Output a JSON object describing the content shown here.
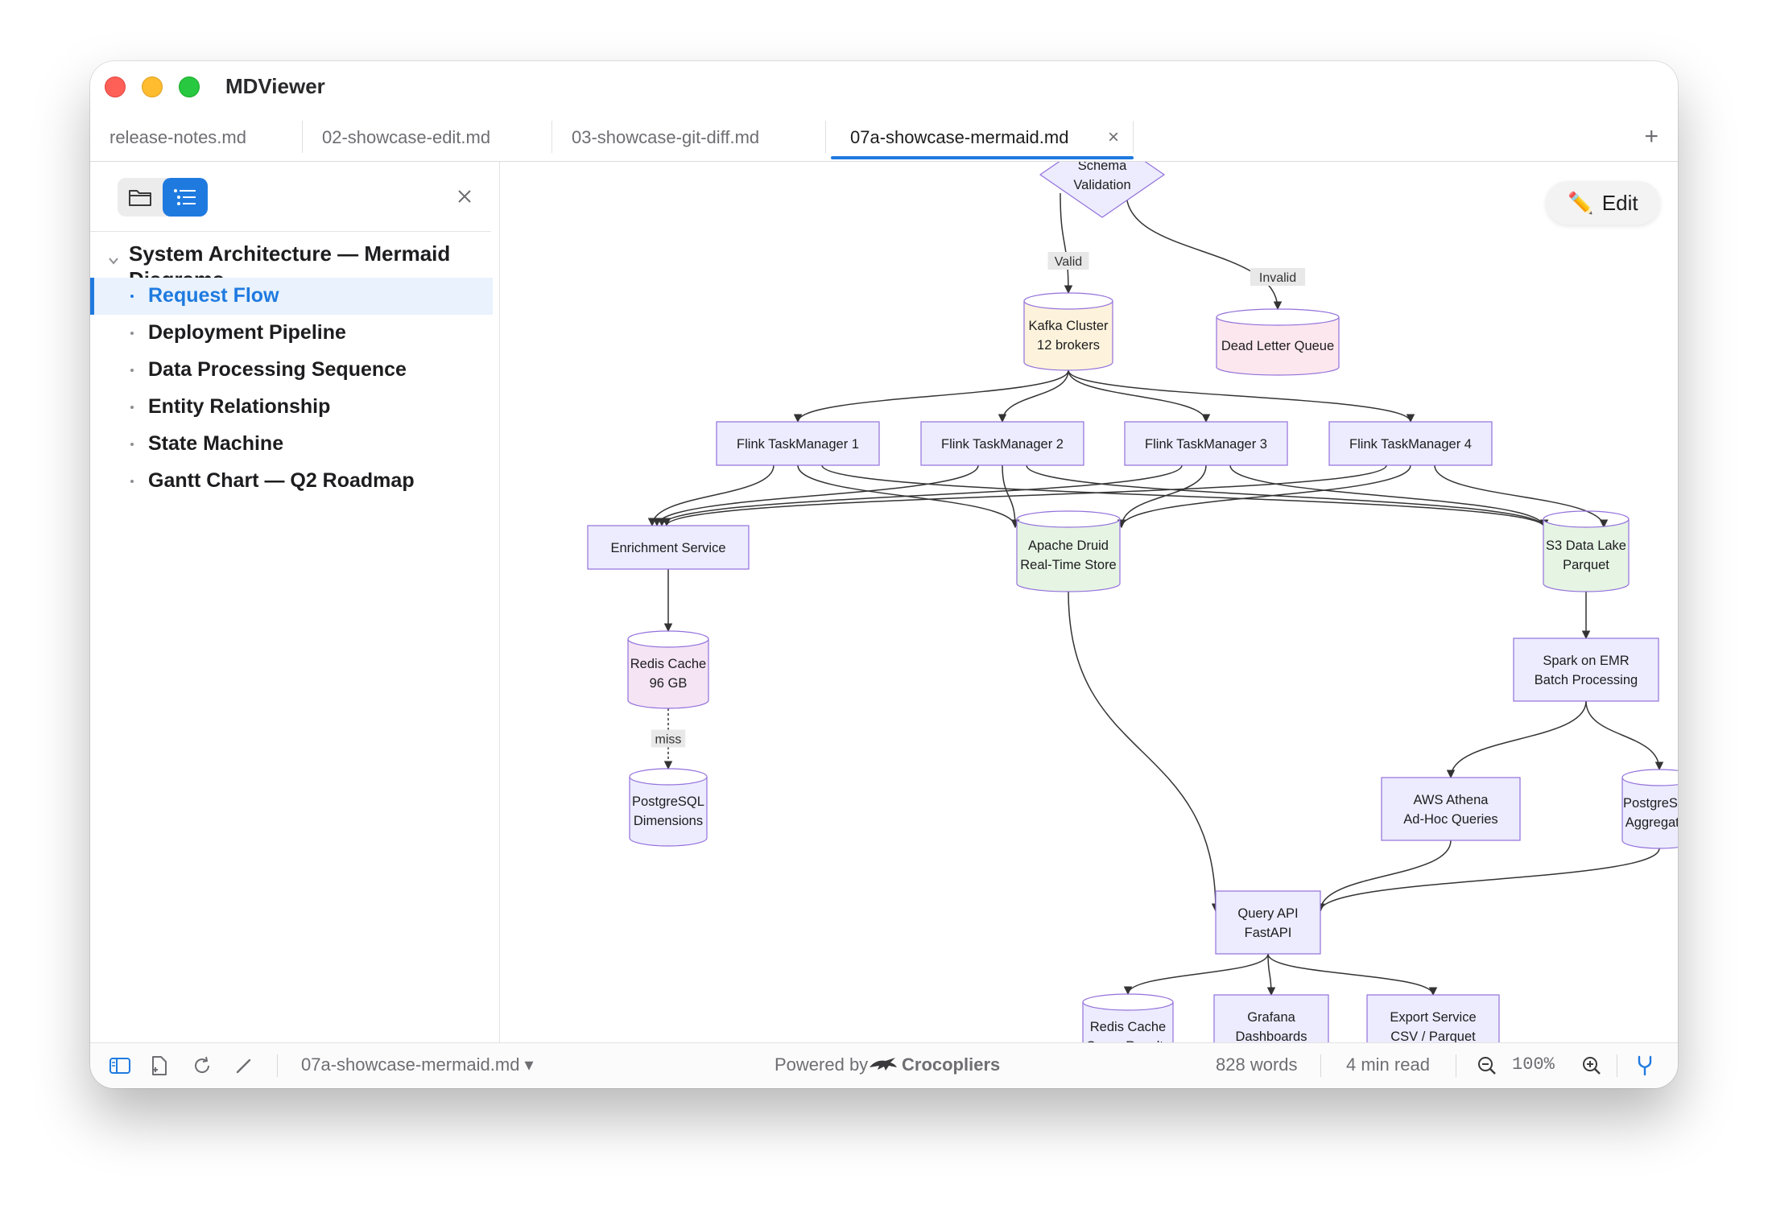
{
  "app": {
    "title": "MDViewer"
  },
  "tabs": [
    {
      "label": "release-notes.md"
    },
    {
      "label": "02-showcase-edit.md"
    },
    {
      "label": "03-showcase-git-diff.md"
    },
    {
      "label": "07a-showcase-mermaid.md",
      "active": true,
      "close_glyph": "×"
    }
  ],
  "tab_add_glyph": "+",
  "sidebar": {
    "outline_title": "System Architecture — Mermaid Diagrams",
    "items": [
      {
        "label": "Request Flow",
        "active": true
      },
      {
        "label": "Deployment Pipeline"
      },
      {
        "label": "Data Processing Sequence"
      },
      {
        "label": "Entity Relationship"
      },
      {
        "label": "State Machine"
      },
      {
        "label": "Gantt Chart — Q2 Roadmap"
      }
    ],
    "icons": [
      "folder-icon",
      "outline-list-icon",
      "close-icon"
    ]
  },
  "edit_button": {
    "label": "Edit",
    "icon": "✏️"
  },
  "diagram": {
    "nodes": [
      {
        "id": "validation",
        "lines": [
          "Schema",
          "Validation"
        ],
        "shape": "diamond"
      },
      {
        "id": "kafka",
        "lines": [
          "Kafka Cluster",
          "12 brokers"
        ],
        "shape": "cylinder",
        "fill": "#fdf3dc"
      },
      {
        "id": "dlq",
        "lines": [
          "Dead Letter Queue"
        ],
        "shape": "cylinder",
        "fill": "#fce7ee"
      },
      {
        "id": "flink1",
        "lines": [
          "Flink TaskManager 1"
        ],
        "shape": "rect"
      },
      {
        "id": "flink2",
        "lines": [
          "Flink TaskManager 2"
        ],
        "shape": "rect"
      },
      {
        "id": "flink3",
        "lines": [
          "Flink TaskManager 3"
        ],
        "shape": "rect"
      },
      {
        "id": "flink4",
        "lines": [
          "Flink TaskManager 4"
        ],
        "shape": "rect"
      },
      {
        "id": "enrich",
        "lines": [
          "Enrichment Service"
        ],
        "shape": "rect"
      },
      {
        "id": "druid",
        "lines": [
          "Apache Druid",
          "Real-Time Store"
        ],
        "shape": "cylinder",
        "fill": "#e6f4e4"
      },
      {
        "id": "s3",
        "lines": [
          "S3 Data Lake",
          "Parquet"
        ],
        "shape": "cylinder",
        "fill": "#e6f4e4"
      },
      {
        "id": "redis1",
        "lines": [
          "Redis Cache",
          "96 GB"
        ],
        "shape": "cylinder",
        "fill": "#f4e4f4"
      },
      {
        "id": "pgdim",
        "lines": [
          "PostgreSQL",
          "Dimensions"
        ],
        "shape": "cylinder",
        "fill": "#ececfe"
      },
      {
        "id": "spark",
        "lines": [
          "Spark on EMR",
          "Batch Processing"
        ],
        "shape": "rect"
      },
      {
        "id": "athena",
        "lines": [
          "AWS Athena",
          "Ad-Hoc Queries"
        ],
        "shape": "rect"
      },
      {
        "id": "pgagg",
        "lines": [
          "PostgreSQL",
          "Aggregates"
        ],
        "shape": "cylinder",
        "fill": "#ececfe"
      },
      {
        "id": "api",
        "lines": [
          "Query API",
          "FastAPI"
        ],
        "shape": "rect"
      },
      {
        "id": "redis2",
        "lines": [
          "Redis Cache",
          "Query Results"
        ],
        "shape": "cylinder",
        "fill": "#ececfe"
      },
      {
        "id": "grafana",
        "lines": [
          "Grafana",
          "Dashboards"
        ],
        "shape": "rect"
      },
      {
        "id": "export",
        "lines": [
          "Export Service",
          "CSV / Parquet"
        ],
        "shape": "rect"
      }
    ],
    "edges": [
      {
        "from": "validation",
        "to": "kafka",
        "label": "Valid"
      },
      {
        "from": "validation",
        "to": "dlq",
        "label": "Invalid"
      },
      {
        "from": "kafka",
        "to": "flink1"
      },
      {
        "from": "kafka",
        "to": "flink2"
      },
      {
        "from": "kafka",
        "to": "flink3"
      },
      {
        "from": "kafka",
        "to": "flink4"
      },
      {
        "from": "flink1",
        "to": "enrich"
      },
      {
        "from": "flink1",
        "to": "druid"
      },
      {
        "from": "flink1",
        "to": "s3"
      },
      {
        "from": "flink2",
        "to": "enrich"
      },
      {
        "from": "flink2",
        "to": "druid"
      },
      {
        "from": "flink2",
        "to": "s3"
      },
      {
        "from": "flink3",
        "to": "enrich"
      },
      {
        "from": "flink3",
        "to": "druid"
      },
      {
        "from": "flink3",
        "to": "s3"
      },
      {
        "from": "flink4",
        "to": "enrich"
      },
      {
        "from": "flink4",
        "to": "druid"
      },
      {
        "from": "flink4",
        "to": "s3"
      },
      {
        "from": "enrich",
        "to": "redis1"
      },
      {
        "from": "redis1",
        "to": "pgdim",
        "label": "miss",
        "dashed": true
      },
      {
        "from": "s3",
        "to": "spark"
      },
      {
        "from": "spark",
        "to": "athena"
      },
      {
        "from": "spark",
        "to": "pgagg"
      },
      {
        "from": "druid",
        "to": "api"
      },
      {
        "from": "athena",
        "to": "api"
      },
      {
        "from": "pgagg",
        "to": "api"
      },
      {
        "from": "api",
        "to": "redis2"
      },
      {
        "from": "api",
        "to": "grafana"
      },
      {
        "from": "api",
        "to": "export"
      }
    ],
    "colors": {
      "node_fill": "#ececfe",
      "node_stroke": "#9370db",
      "edge": "#333333",
      "label_bg": "#e8e8e8"
    }
  },
  "statusbar": {
    "file": "07a-showcase-mermaid.md ▾",
    "powered_by": "Powered by",
    "brand": "Crocopliers",
    "words": "828 words",
    "read_time": "4 min read",
    "zoom": "100%"
  }
}
